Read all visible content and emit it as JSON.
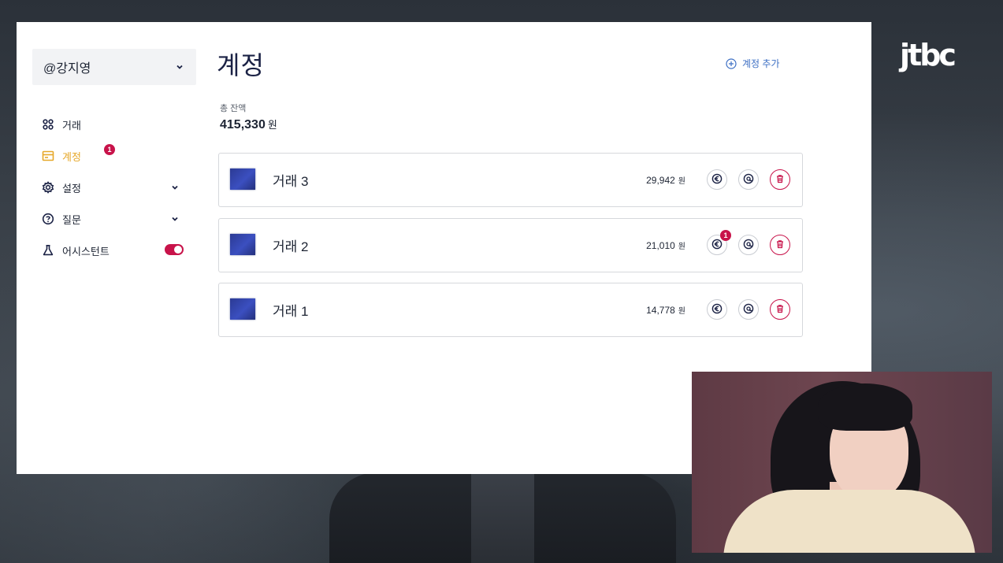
{
  "broadcast": {
    "logo_text": "jtbc"
  },
  "account_selector": {
    "value": "@강지영"
  },
  "nav": {
    "items": [
      {
        "label": "거래",
        "icon": "grid-icon"
      },
      {
        "label": "계정",
        "icon": "wallet-icon",
        "active": true,
        "badge": "1"
      },
      {
        "label": "설정",
        "icon": "gear-icon"
      },
      {
        "label": "질문",
        "icon": "help-circle-icon"
      },
      {
        "label": "어시스턴트",
        "icon": "flask-icon",
        "toggle_on": true
      }
    ]
  },
  "main": {
    "title": "계정",
    "add_account_label": "계정 추가",
    "balance_label": "총 잔액",
    "balance_value": "415,330",
    "currency_unit": "원",
    "accounts": [
      {
        "name": "거래 3",
        "amount": "29,942",
        "unit": "원"
      },
      {
        "name": "거래 2",
        "amount": "21,010",
        "unit": "원",
        "badge": "1"
      },
      {
        "name": "거래 1",
        "amount": "14,778",
        "unit": "원"
      }
    ]
  },
  "colors": {
    "accent": "#e6a82a",
    "danger": "#c8134a",
    "link": "#3d6fc4",
    "navy": "#1b2245"
  }
}
